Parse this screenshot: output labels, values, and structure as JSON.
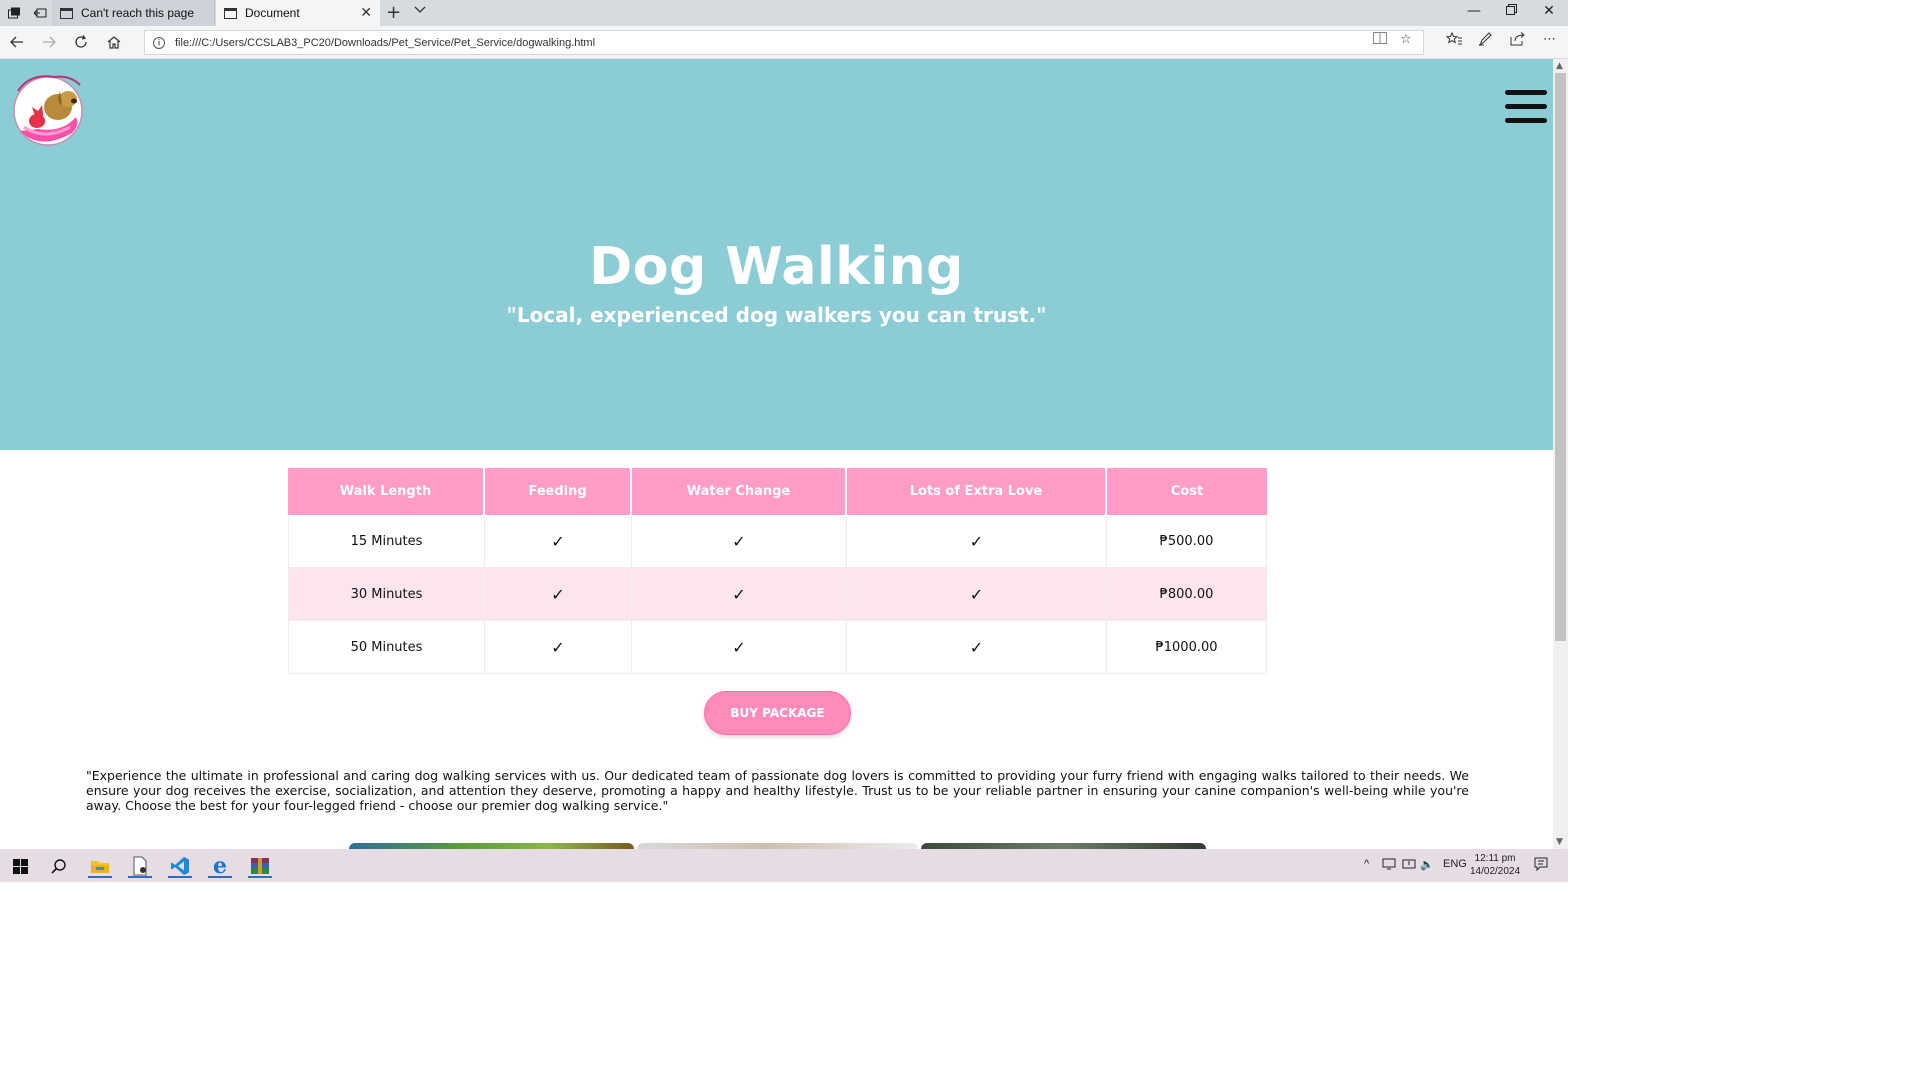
{
  "browser": {
    "tabs": [
      {
        "label": "Can't reach this page",
        "active": false
      },
      {
        "label": "Document",
        "active": true
      }
    ],
    "url": "file:///C:/Users/CCSLAB3_PC20/Downloads/Pet_Service/Pet_Service/dogwalking.html"
  },
  "page": {
    "hero": {
      "title": "Dog Walking",
      "subtitle": "\"Local, experienced dog walkers you can trust.\""
    },
    "table": {
      "headers": [
        "Walk Length",
        "Feeding",
        "Water Change",
        "Lots of Extra Love",
        "Cost"
      ],
      "rows": [
        {
          "length": "15 Minutes",
          "cost": "₱500.00"
        },
        {
          "length": "30 Minutes",
          "cost": "₱800.00"
        },
        {
          "length": "50 Minutes",
          "cost": "₱1000.00"
        }
      ],
      "check_glyph": "✓"
    },
    "buy_button": "BUY PACKAGE",
    "description": "\"Experience the ultimate in professional and caring dog walking services with us. Our dedicated team of passionate dog lovers is committed to providing your furry friend with engaging walks tailored to their needs. We ensure your dog receives the exercise, socialization, and attention they deserve, promoting a happy and healthy lifestyle. Trust us to be your reliable partner in ensuring your canine companion's well-being while you're away. Choose the best for your four-legged friend - choose our premier dog walking service.\""
  },
  "taskbar": {
    "language": "ENG",
    "time": "12:11 pm",
    "date": "14/02/2024"
  },
  "colors": {
    "hero_bg": "#8ccdd5",
    "table_header": "#ff9cc8",
    "alt_row": "#fde4ef",
    "button": "#ff8bbd"
  }
}
